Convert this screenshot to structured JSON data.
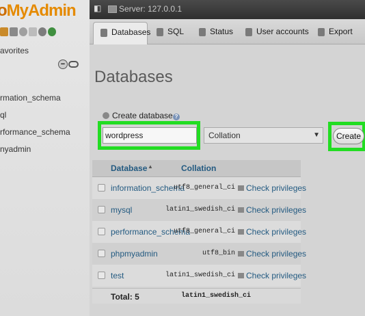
{
  "nav": {
    "logo_prefix": "o",
    "logo_name": "MyAdmin",
    "favorites_label": "avorites",
    "databases": [
      "rmation_schema",
      "ql",
      "rformance_schema",
      "nyadmin"
    ]
  },
  "topbar": {
    "server_label": "Server: 127.0.0.1"
  },
  "tabs": [
    {
      "label": "Databases",
      "icon": "database-icon",
      "active": true
    },
    {
      "label": "SQL",
      "icon": "sql-icon"
    },
    {
      "label": "Status",
      "icon": "status-icon"
    },
    {
      "label": "User accounts",
      "icon": "users-icon"
    },
    {
      "label": "Export",
      "icon": "export-icon"
    }
  ],
  "main": {
    "title": "Databases",
    "create_label": "Create database",
    "db_name_value": "wordpress",
    "collation_placeholder": "Collation",
    "create_button": "Create"
  },
  "table": {
    "col_database": "Database",
    "col_collation": "Collation",
    "rows": [
      {
        "name": "information_schema",
        "collation": "utf8_general_ci",
        "action": "Check privileges"
      },
      {
        "name": "mysql",
        "collation": "latin1_swedish_ci",
        "action": "Check privileges"
      },
      {
        "name": "performance_schema",
        "collation": "utf8_general_ci",
        "action": "Check privileges"
      },
      {
        "name": "phpmyadmin",
        "collation": "utf8_bin",
        "action": "Check privileges"
      },
      {
        "name": "test",
        "collation": "latin1_swedish_ci",
        "action": "Check privileges"
      }
    ],
    "total_label": "Total: 5",
    "total_collation": "latin1_swedish_ci"
  },
  "colors": {
    "highlight": "#22dd22",
    "link": "#235a81",
    "logo_orange": "#e58a00"
  }
}
